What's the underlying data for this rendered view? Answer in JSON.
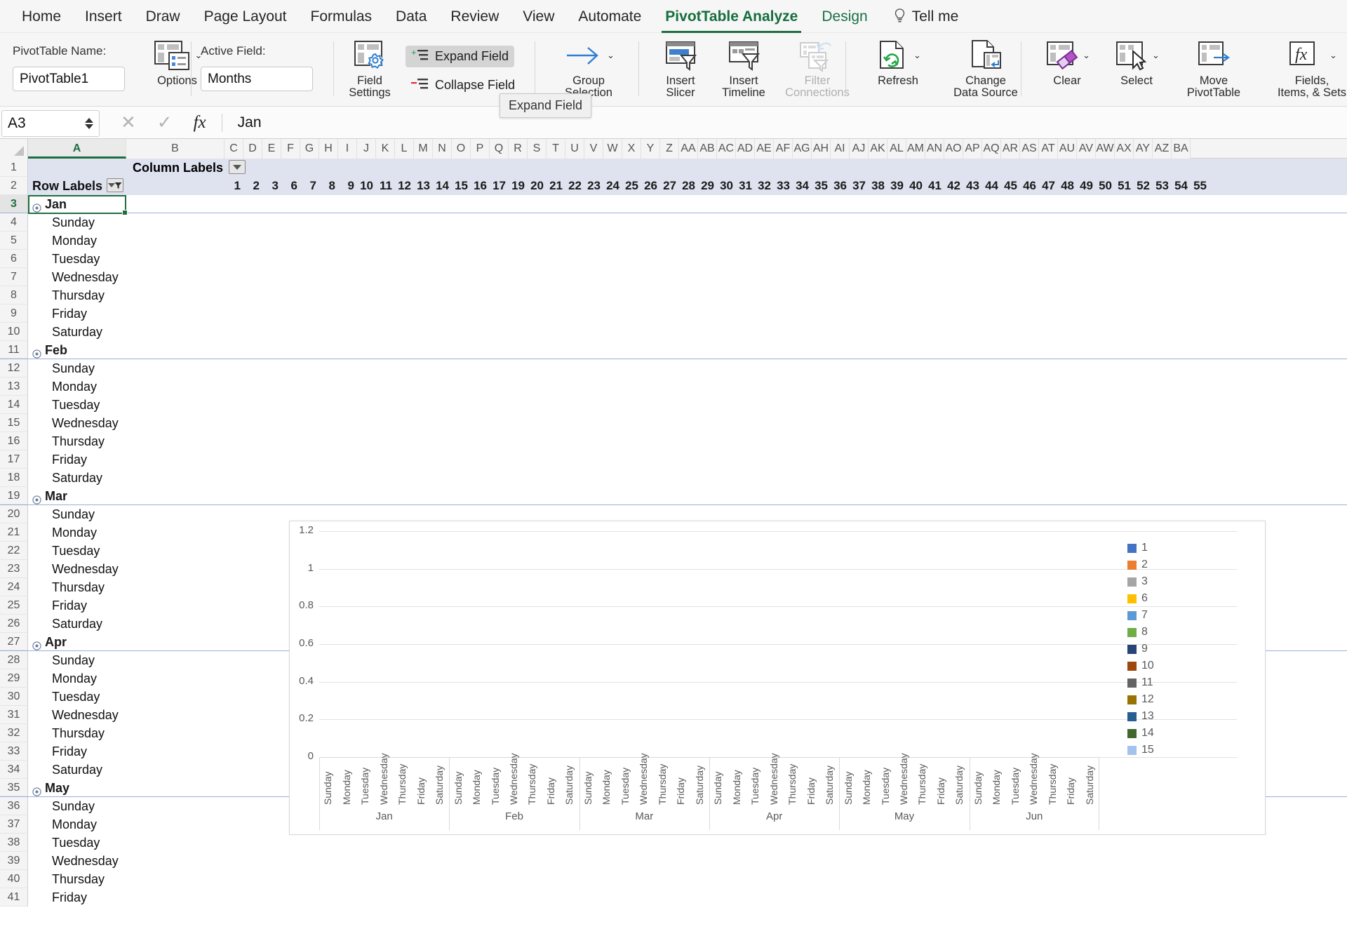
{
  "ribbon_tabs": [
    {
      "label": "Home",
      "active": false
    },
    {
      "label": "Insert",
      "active": false
    },
    {
      "label": "Draw",
      "active": false
    },
    {
      "label": "Page Layout",
      "active": false
    },
    {
      "label": "Formulas",
      "active": false
    },
    {
      "label": "Data",
      "active": false
    },
    {
      "label": "Review",
      "active": false
    },
    {
      "label": "View",
      "active": false
    },
    {
      "label": "Automate",
      "active": false
    },
    {
      "label": "PivotTable Analyze",
      "active": true
    },
    {
      "label": "Design",
      "active": false
    }
  ],
  "tell_me": "Tell me",
  "ribbon": {
    "pivottable_name_label": "PivotTable Name:",
    "pivottable_name_value": "PivotTable1",
    "options_label": "Options",
    "active_field_label": "Active Field:",
    "active_field_value": "Months",
    "field_settings_label_1": "Field",
    "field_settings_label_2": "Settings",
    "expand_field_label": "Expand Field",
    "collapse_field_label": "Collapse Field",
    "group_label_1": "Group",
    "group_label_2": "Selection",
    "insert_slicer_1": "Insert",
    "insert_slicer_2": "Slicer",
    "insert_timeline_1": "Insert",
    "insert_timeline_2": "Timeline",
    "filter_connections_1": "Filter",
    "filter_connections_2": "Connections",
    "refresh_label": "Refresh",
    "change_data_source_1": "Change",
    "change_data_source_2": "Data Source",
    "clear_label": "Clear",
    "select_label": "Select",
    "move_pivottable_1": "Move",
    "move_pivottable_2": "PivotTable",
    "fields_items_sets_1": "Fields,",
    "fields_items_sets_2": "Items, & Sets"
  },
  "tooltip": {
    "text": "Expand Field"
  },
  "formula_bar": {
    "name_box": "A3",
    "cancel_icon": "close-icon",
    "confirm_icon": "check-icon",
    "fx_icon": "fx-icon",
    "content": "Jan"
  },
  "grid": {
    "column_headers": [
      "A",
      "B",
      "C",
      "D",
      "E",
      "F",
      "G",
      "H",
      "I",
      "J",
      "K",
      "L",
      "M",
      "N",
      "O",
      "P",
      "Q",
      "R",
      "S",
      "T",
      "U",
      "V",
      "W",
      "X",
      "Y",
      "Z",
      "AA",
      "AB",
      "AC",
      "AD",
      "AE",
      "AF",
      "AG",
      "AH",
      "AI",
      "AJ",
      "AK",
      "AL",
      "AM",
      "AN",
      "AO",
      "AP",
      "AQ",
      "AR",
      "AS",
      "AT",
      "AU",
      "AV",
      "AW",
      "AX",
      "AY",
      "AZ",
      "BA"
    ],
    "selected_column": "A",
    "row1": {
      "label": "Column Labels",
      "has_dropdown": true
    },
    "row2": {
      "label": "Row Labels",
      "has_filter_dropdown": true,
      "column_values": [
        1,
        2,
        3,
        6,
        7,
        8,
        9,
        10,
        11,
        12,
        13,
        14,
        15,
        16,
        17,
        19,
        20,
        21,
        22,
        23,
        24,
        25,
        26,
        27,
        28,
        29,
        30,
        31,
        32,
        33,
        34,
        35,
        36,
        37,
        38,
        39,
        40,
        41,
        42,
        43,
        44,
        45,
        46,
        47,
        48,
        49,
        50,
        51,
        52,
        53,
        54,
        55
      ]
    },
    "rows": [
      {
        "num": 3,
        "text": "Jan",
        "type": "month",
        "selected": true
      },
      {
        "num": 4,
        "text": "Sunday",
        "type": "day"
      },
      {
        "num": 5,
        "text": "Monday",
        "type": "day"
      },
      {
        "num": 6,
        "text": "Tuesday",
        "type": "day"
      },
      {
        "num": 7,
        "text": "Wednesday",
        "type": "day"
      },
      {
        "num": 8,
        "text": "Thursday",
        "type": "day"
      },
      {
        "num": 9,
        "text": "Friday",
        "type": "day"
      },
      {
        "num": 10,
        "text": "Saturday",
        "type": "day"
      },
      {
        "num": 11,
        "text": "Feb",
        "type": "month"
      },
      {
        "num": 12,
        "text": "Sunday",
        "type": "day"
      },
      {
        "num": 13,
        "text": "Monday",
        "type": "day"
      },
      {
        "num": 14,
        "text": "Tuesday",
        "type": "day"
      },
      {
        "num": 15,
        "text": "Wednesday",
        "type": "day"
      },
      {
        "num": 16,
        "text": "Thursday",
        "type": "day"
      },
      {
        "num": 17,
        "text": "Friday",
        "type": "day"
      },
      {
        "num": 18,
        "text": "Saturday",
        "type": "day"
      },
      {
        "num": 19,
        "text": "Mar",
        "type": "month"
      },
      {
        "num": 20,
        "text": "Sunday",
        "type": "day"
      },
      {
        "num": 21,
        "text": "Monday",
        "type": "day"
      },
      {
        "num": 22,
        "text": "Tuesday",
        "type": "day"
      },
      {
        "num": 23,
        "text": "Wednesday",
        "type": "day"
      },
      {
        "num": 24,
        "text": "Thursday",
        "type": "day"
      },
      {
        "num": 25,
        "text": "Friday",
        "type": "day"
      },
      {
        "num": 26,
        "text": "Saturday",
        "type": "day"
      },
      {
        "num": 27,
        "text": "Apr",
        "type": "month"
      },
      {
        "num": 28,
        "text": "Sunday",
        "type": "day"
      },
      {
        "num": 29,
        "text": "Monday",
        "type": "day"
      },
      {
        "num": 30,
        "text": "Tuesday",
        "type": "day"
      },
      {
        "num": 31,
        "text": "Wednesday",
        "type": "day"
      },
      {
        "num": 32,
        "text": "Thursday",
        "type": "day"
      },
      {
        "num": 33,
        "text": "Friday",
        "type": "day"
      },
      {
        "num": 34,
        "text": "Saturday",
        "type": "day"
      },
      {
        "num": 35,
        "text": "May",
        "type": "month"
      },
      {
        "num": 36,
        "text": "Sunday",
        "type": "day"
      },
      {
        "num": 37,
        "text": "Monday",
        "type": "day"
      },
      {
        "num": 38,
        "text": "Tuesday",
        "type": "day"
      },
      {
        "num": 39,
        "text": "Wednesday",
        "type": "day"
      },
      {
        "num": 40,
        "text": "Thursday",
        "type": "day"
      },
      {
        "num": 41,
        "text": "Friday",
        "type": "day"
      }
    ]
  },
  "chart_data": {
    "type": "bar",
    "title": "",
    "xlabel": "",
    "ylabel": "",
    "ylim": [
      0,
      1.2
    ],
    "yticks": [
      0,
      0.2,
      0.4,
      0.6,
      0.8,
      1,
      1.2
    ],
    "ytick_labels": [
      "0",
      "0.2",
      "0.4",
      "0.6",
      "0.8",
      "1",
      "1.2"
    ],
    "grid": true,
    "legend_position": "right",
    "months": [
      "Jan",
      "Feb",
      "Mar",
      "Apr",
      "May",
      "Jun"
    ],
    "days": [
      "Sunday",
      "Monday",
      "Tuesday",
      "Wednesday",
      "Thursday",
      "Friday",
      "Saturday"
    ],
    "categories": [
      "Jan/Sunday",
      "Jan/Monday",
      "Jan/Tuesday",
      "Jan/Wednesday",
      "Jan/Thursday",
      "Jan/Friday",
      "Jan/Saturday",
      "Feb/Sunday",
      "Feb/Monday",
      "Feb/Tuesday",
      "Feb/Wednesday",
      "Feb/Thursday",
      "Feb/Friday",
      "Feb/Saturday",
      "Mar/Sunday",
      "Mar/Monday",
      "Mar/Tuesday",
      "Mar/Wednesday",
      "Mar/Thursday",
      "Mar/Friday",
      "Mar/Saturday",
      "Apr/Sunday",
      "Apr/Monday",
      "Apr/Tuesday",
      "Apr/Wednesday",
      "Apr/Thursday",
      "Apr/Friday",
      "Apr/Saturday",
      "May/Sunday",
      "May/Monday",
      "May/Tuesday",
      "May/Wednesday",
      "May/Thursday",
      "May/Friday",
      "May/Saturday",
      "Jun/Sunday",
      "Jun/Monday",
      "Jun/Tuesday",
      "Jun/Wednesday",
      "Jun/Thursday",
      "Jun/Friday",
      "Jun/Saturday"
    ],
    "series": [
      {
        "name": "1",
        "color": "#4472C4",
        "values": []
      },
      {
        "name": "2",
        "color": "#ED7D31",
        "values": []
      },
      {
        "name": "3",
        "color": "#A5A5A5",
        "values": []
      },
      {
        "name": "6",
        "color": "#FFC000",
        "values": []
      },
      {
        "name": "7",
        "color": "#5B9BD5",
        "values": []
      },
      {
        "name": "8",
        "color": "#70AD47",
        "values": []
      },
      {
        "name": "9",
        "color": "#264478",
        "values": []
      },
      {
        "name": "10",
        "color": "#9E480E",
        "values": []
      },
      {
        "name": "11",
        "color": "#636363",
        "values": []
      },
      {
        "name": "12",
        "color": "#997300",
        "values": []
      },
      {
        "name": "13",
        "color": "#255E91",
        "values": []
      },
      {
        "name": "14",
        "color": "#43682B",
        "values": []
      },
      {
        "name": "15",
        "color": "#A5C2EA",
        "values": []
      }
    ]
  }
}
